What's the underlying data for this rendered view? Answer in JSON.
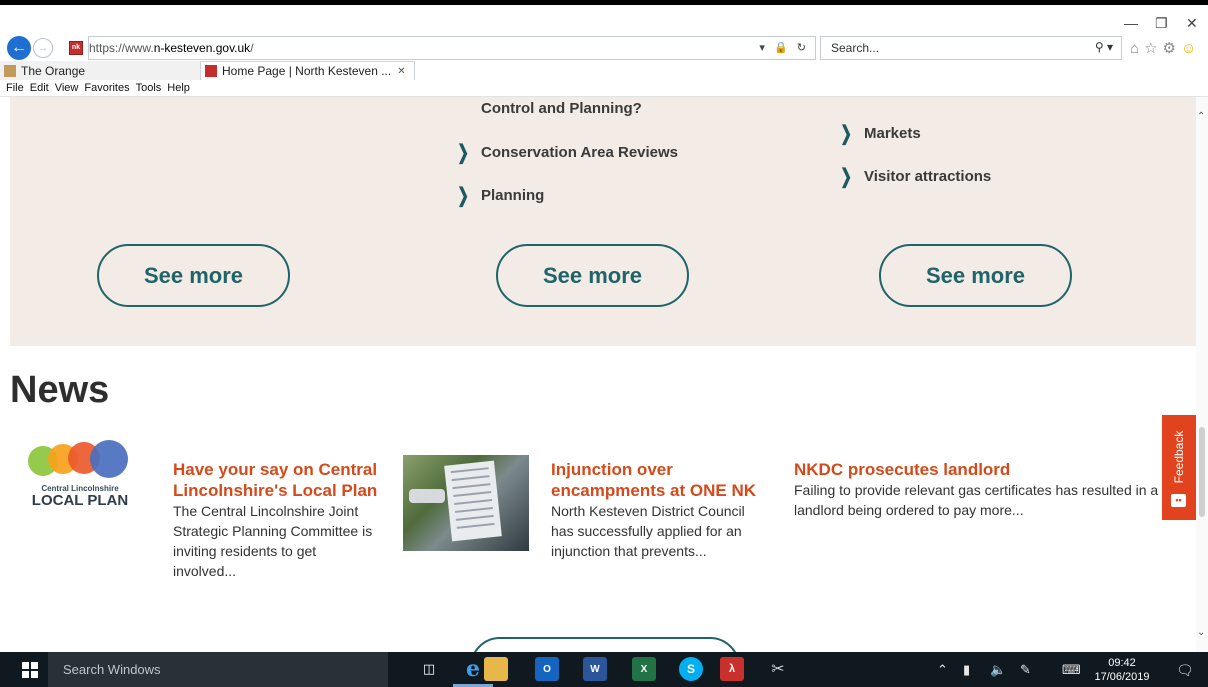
{
  "browser": {
    "url_prefix": "https://www.",
    "url_domain": "n-kesteven.gov.uk",
    "url_suffix": "/",
    "search_placeholder": "Search...",
    "tabs": [
      {
        "label": "The Orange",
        "active": false
      },
      {
        "label": "Home Page | North Kesteven ...",
        "active": true
      }
    ],
    "menu": [
      "File",
      "Edit",
      "View",
      "Favorites",
      "Tools",
      "Help"
    ]
  },
  "services": {
    "col2": [
      "Control and Planning?",
      "Conservation Area Reviews",
      "Planning"
    ],
    "col3": [
      "Markets",
      "Visitor attractions"
    ],
    "see_more": "See more"
  },
  "news": {
    "heading": "News",
    "items": [
      {
        "title_lines": [
          "Have your say on Central",
          "Lincolnshire's Local Plan"
        ],
        "summary_lines": [
          "The Central Lincolnshire Joint",
          "Strategic Planning Committee is",
          "inviting residents to get",
          "involved..."
        ],
        "logo_line1": "Central Lincolnshire",
        "logo_line2": "LOCAL PLAN"
      },
      {
        "title_lines": [
          "Injunction over",
          "encampments at ONE NK"
        ],
        "summary_lines": [
          "North Kesteven District Council",
          "has successfully applied for an",
          "injunction that prevents..."
        ]
      },
      {
        "title_lines": [
          "NKDC prosecutes landlord"
        ],
        "summary_lines": [
          "Failing to provide relevant gas certificates has resulted in a",
          "landlord being ordered to pay more..."
        ]
      }
    ]
  },
  "feedback": {
    "label": "Feedback"
  },
  "taskbar": {
    "search_placeholder": "Search Windows",
    "time": "09:42",
    "date": "17/06/2019"
  },
  "colors": {
    "teal": "#1f6468",
    "news_title": "#d44a1b",
    "beige_band": "#f2ebe6",
    "feedback": "#e2431f"
  }
}
